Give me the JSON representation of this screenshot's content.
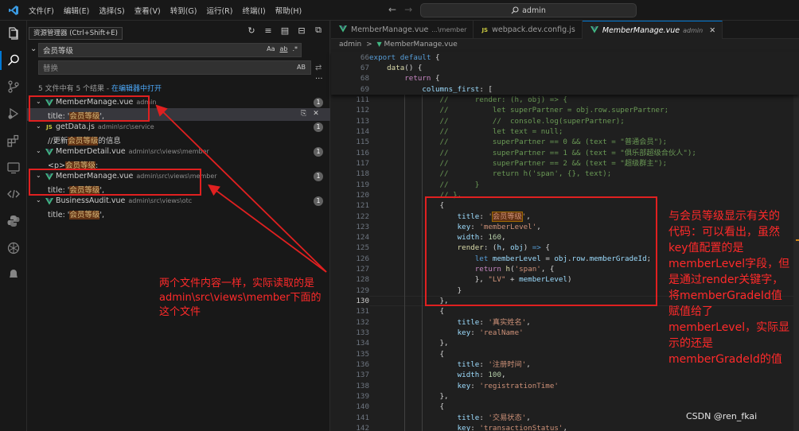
{
  "titlebar": {
    "menu": [
      "文件(F)",
      "编辑(E)",
      "选择(S)",
      "查看(V)",
      "转到(G)",
      "运行(R)",
      "终端(I)",
      "帮助(H)"
    ],
    "command_center": "admin"
  },
  "tooltip": "资源管理器 (Ctrl+Shift+E)",
  "search": {
    "query": "会员等级",
    "options": [
      "Aa",
      "ab",
      ".*"
    ],
    "replace_placeholder": "替换",
    "replace_option": "AB",
    "summary_text": "5 文件中有 5 个结果 - ",
    "summary_link": "在编辑器中打开"
  },
  "results": [
    {
      "name": "MemberManage.vue",
      "path": "admin",
      "icon": "vue-icon",
      "count": "1",
      "match_pre": "title: '",
      "match_hl": "会员等级",
      "match_post": "',"
    },
    {
      "name": "getData.js",
      "path": "admin\\src\\service",
      "icon": "js-icon",
      "count": "1",
      "match_pre": "//更新",
      "match_hl": "会员等级",
      "match_post": "的信息"
    },
    {
      "name": "MemberDetail.vue",
      "path": "admin\\src\\views\\member",
      "icon": "vue-icon",
      "count": "1",
      "match_pre": "<p>",
      "match_hl": "会员等级",
      "match_post": ":"
    },
    {
      "name": "MemberManage.vue",
      "path": "admin\\src\\views\\member",
      "icon": "vue-icon",
      "count": "1",
      "match_pre": "title: '",
      "match_hl": "会员等级",
      "match_post": "',"
    },
    {
      "name": "BusinessAudit.vue",
      "path": "admin\\src\\views\\otc",
      "icon": "vue-icon",
      "count": "1",
      "match_pre": "title: '",
      "match_hl": "会员等级",
      "match_post": "',"
    }
  ],
  "tabs": [
    {
      "name": "MemberManage.vue",
      "sub": "...\\member",
      "icon": "vue-icon"
    },
    {
      "name": "webpack.dev.config.js",
      "sub": "",
      "icon": "js-icon"
    },
    {
      "name": "MemberManage.vue",
      "sub": "admin",
      "icon": "vue-icon"
    }
  ],
  "breadcrumb": {
    "root": "admin",
    "sep": ">",
    "file": "MemberManage.vue"
  },
  "sticky_lines": [
    {
      "ln": "66",
      "code": [
        [
          "k",
          "export"
        ],
        [
          "t",
          " "
        ],
        [
          "k",
          "default"
        ],
        [
          "t",
          " {"
        ]
      ]
    },
    {
      "ln": "67",
      "code": [
        [
          "t",
          "    "
        ],
        [
          "f",
          "data"
        ],
        [
          "t",
          "() {"
        ]
      ]
    },
    {
      "ln": "68",
      "code": [
        [
          "t",
          "        "
        ],
        [
          "kc",
          "return"
        ],
        [
          "t",
          " {"
        ]
      ]
    },
    {
      "ln": "69",
      "code": [
        [
          "t",
          "            "
        ],
        [
          "p",
          "columns_first"
        ],
        [
          "t",
          ": ["
        ]
      ]
    }
  ],
  "code_lines": [
    {
      "ln": "111",
      "code": [
        [
          "t",
          "                "
        ],
        [
          "c",
          "//      render: (h, obj) => {"
        ]
      ]
    },
    {
      "ln": "112",
      "code": [
        [
          "t",
          "                "
        ],
        [
          "c",
          "//          let superPartner = obj.row.superPartner;"
        ]
      ]
    },
    {
      "ln": "113",
      "code": [
        [
          "t",
          "                "
        ],
        [
          "c",
          "//          //  console.log(superPartner);"
        ]
      ]
    },
    {
      "ln": "114",
      "code": [
        [
          "t",
          "                "
        ],
        [
          "c",
          "//          let text = null;"
        ]
      ]
    },
    {
      "ln": "115",
      "code": [
        [
          "t",
          "                "
        ],
        [
          "c",
          "//          superPartner == 0 && (text = \"普通会员\");"
        ]
      ]
    },
    {
      "ln": "116",
      "code": [
        [
          "t",
          "                "
        ],
        [
          "c",
          "//          superPartner == 1 && (text = \"俱乐部超级合伙人\");"
        ]
      ]
    },
    {
      "ln": "117",
      "code": [
        [
          "t",
          "                "
        ],
        [
          "c",
          "//          superPartner == 2 && (text = \"超级群主\");"
        ]
      ]
    },
    {
      "ln": "118",
      "code": [
        [
          "t",
          "                "
        ],
        [
          "c",
          "//          return h('span', {}, text);"
        ]
      ]
    },
    {
      "ln": "119",
      "code": [
        [
          "t",
          "                "
        ],
        [
          "c",
          "//      }"
        ]
      ]
    },
    {
      "ln": "120",
      "code": [
        [
          "t",
          "                "
        ],
        [
          "c",
          "// },"
        ]
      ]
    },
    {
      "ln": "121",
      "code": [
        [
          "t",
          "                {"
        ]
      ]
    },
    {
      "ln": "122",
      "code": [
        [
          "t",
          "                    "
        ],
        [
          "p",
          "title"
        ],
        [
          "t",
          ": "
        ],
        [
          "s",
          "'"
        ],
        [
          "fhl",
          "会员等级"
        ],
        [
          "s",
          "'"
        ],
        [
          "t",
          ","
        ]
      ]
    },
    {
      "ln": "123",
      "code": [
        [
          "t",
          "                    "
        ],
        [
          "p",
          "key"
        ],
        [
          "t",
          ": "
        ],
        [
          "s",
          "'memberLevel'"
        ],
        [
          "t",
          ","
        ]
      ]
    },
    {
      "ln": "124",
      "code": [
        [
          "t",
          "                    "
        ],
        [
          "p",
          "width"
        ],
        [
          "t",
          ": "
        ],
        [
          "n",
          "160"
        ],
        [
          "t",
          ","
        ]
      ]
    },
    {
      "ln": "125",
      "code": [
        [
          "t",
          "                    "
        ],
        [
          "f",
          "render"
        ],
        [
          "t",
          ": ("
        ],
        [
          "p",
          "h"
        ],
        [
          "t",
          ", "
        ],
        [
          "p",
          "obj"
        ],
        [
          "t",
          ") "
        ],
        [
          "k",
          "=>"
        ],
        [
          "t",
          " {"
        ]
      ]
    },
    {
      "ln": "126",
      "code": [
        [
          "t",
          "                        "
        ],
        [
          "k",
          "let"
        ],
        [
          "t",
          " "
        ],
        [
          "p",
          "memberLevel"
        ],
        [
          "t",
          " = "
        ],
        [
          "p",
          "obj"
        ],
        [
          "t",
          "."
        ],
        [
          "p",
          "row"
        ],
        [
          "t",
          "."
        ],
        [
          "p",
          "memberGradeId"
        ],
        [
          "t",
          ";"
        ]
      ]
    },
    {
      "ln": "127",
      "code": [
        [
          "t",
          "                        "
        ],
        [
          "kc",
          "return"
        ],
        [
          "t",
          " "
        ],
        [
          "f",
          "h"
        ],
        [
          "t",
          "("
        ],
        [
          "s",
          "'span'"
        ],
        [
          "t",
          ", {"
        ]
      ]
    },
    {
      "ln": "128",
      "code": [
        [
          "t",
          "                        }, "
        ],
        [
          "s",
          "\"LV\""
        ],
        [
          "t",
          " + "
        ],
        [
          "p",
          "memberLevel"
        ],
        [
          "t",
          ")"
        ]
      ]
    },
    {
      "ln": "129",
      "code": [
        [
          "t",
          "                    }"
        ]
      ]
    },
    {
      "ln": "130",
      "code": [
        [
          "t",
          "                },"
        ]
      ],
      "current": true
    },
    {
      "ln": "131",
      "code": [
        [
          "t",
          "                {"
        ]
      ]
    },
    {
      "ln": "132",
      "code": [
        [
          "t",
          "                    "
        ],
        [
          "p",
          "title"
        ],
        [
          "t",
          ": "
        ],
        [
          "s",
          "'真实姓名'"
        ],
        [
          "t",
          ","
        ]
      ]
    },
    {
      "ln": "133",
      "code": [
        [
          "t",
          "                    "
        ],
        [
          "p",
          "key"
        ],
        [
          "t",
          ": "
        ],
        [
          "s",
          "'realName'"
        ]
      ]
    },
    {
      "ln": "134",
      "code": [
        [
          "t",
          "                },"
        ]
      ]
    },
    {
      "ln": "135",
      "code": [
        [
          "t",
          "                {"
        ]
      ]
    },
    {
      "ln": "136",
      "code": [
        [
          "t",
          "                    "
        ],
        [
          "p",
          "title"
        ],
        [
          "t",
          ": "
        ],
        [
          "s",
          "'注册时间'"
        ],
        [
          "t",
          ","
        ]
      ]
    },
    {
      "ln": "137",
      "code": [
        [
          "t",
          "                    "
        ],
        [
          "p",
          "width"
        ],
        [
          "t",
          ": "
        ],
        [
          "n",
          "100"
        ],
        [
          "t",
          ","
        ]
      ]
    },
    {
      "ln": "138",
      "code": [
        [
          "t",
          "                    "
        ],
        [
          "p",
          "key"
        ],
        [
          "t",
          ": "
        ],
        [
          "s",
          "'registrationTime'"
        ]
      ]
    },
    {
      "ln": "139",
      "code": [
        [
          "t",
          "                },"
        ]
      ]
    },
    {
      "ln": "140",
      "code": [
        [
          "t",
          "                {"
        ]
      ]
    },
    {
      "ln": "141",
      "code": [
        [
          "t",
          "                    "
        ],
        [
          "p",
          "title"
        ],
        [
          "t",
          ": "
        ],
        [
          "s",
          "'交易状态'"
        ],
        [
          "t",
          ","
        ]
      ]
    },
    {
      "ln": "142",
      "code": [
        [
          "t",
          "                    "
        ],
        [
          "p",
          "key"
        ],
        [
          "t",
          ": "
        ],
        [
          "s",
          "'transactionStatus'"
        ],
        [
          "t",
          ","
        ]
      ]
    }
  ],
  "annotations": {
    "left": [
      "两个文件内容一样，实际读取的是",
      "admin\\src\\views\\member下面的",
      "这个文件"
    ],
    "right": [
      "与会员等级显示有关的",
      "代码：可以看出，虽然",
      "key值配置的是",
      "memberLevel字段，但",
      "是通过render关键字，",
      "将memberGradeId值",
      "赋值给了",
      "memberLevel，实际显",
      "示的还是",
      "memberGradeId的值"
    ]
  },
  "watermark": "CSDN @ren_fkai",
  "colors": {
    "accent": "#0078d4",
    "annotation_red": "#e02020",
    "match_highlight": "#613214"
  }
}
